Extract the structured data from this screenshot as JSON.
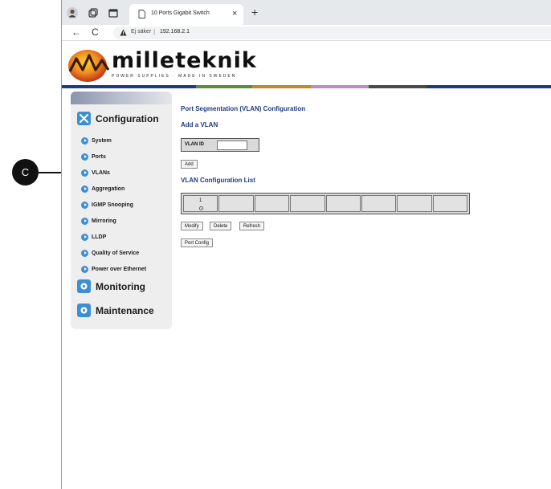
{
  "browser": {
    "tab_title": "10 Ports Gigabit Switch",
    "tab_close": "×",
    "new_tab": "+",
    "back": "←",
    "reload": "C",
    "security_label": "Ej säker",
    "separator": "|",
    "url": "192.168.2.1"
  },
  "logo": {
    "name": "milleteknik",
    "tagline": "POWER SUPPLIES · MADE IN SWEDEN"
  },
  "sidebar": {
    "configuration": "Configuration",
    "items": [
      {
        "label": "System"
      },
      {
        "label": "Ports"
      },
      {
        "label": "VLANs"
      },
      {
        "label": "Aggregation"
      },
      {
        "label": "IGMP Snooping"
      },
      {
        "label": "Mirroring"
      },
      {
        "label": "LLDP"
      },
      {
        "label": "Quality of Service"
      },
      {
        "label": "Power over Ethernet"
      }
    ],
    "monitoring": "Monitoring",
    "maintenance": "Maintenance"
  },
  "annotation": {
    "letter": "C"
  },
  "main": {
    "title": "Port Segmentation (VLAN) Configuration",
    "add_heading": "Add a VLAN",
    "vlan_id_label": "VLAN ID",
    "vlan_id_value": "",
    "add_button": "Add",
    "list_heading": "VLAN Configuration List",
    "vlan_list": [
      {
        "id": "1"
      }
    ],
    "modify_button": "Modify",
    "delete_button": "Delete",
    "refresh_button": "Refresh",
    "port_config_button": "Port Config"
  },
  "colors": {
    "accent": "#3d8fd4",
    "heading": "#1f3a80",
    "stripe": [
      "#1f3a80",
      "#5a8a3a",
      "#c08a2a",
      "#b98fc1",
      "#4a4a4a",
      "#1f3a80"
    ]
  }
}
